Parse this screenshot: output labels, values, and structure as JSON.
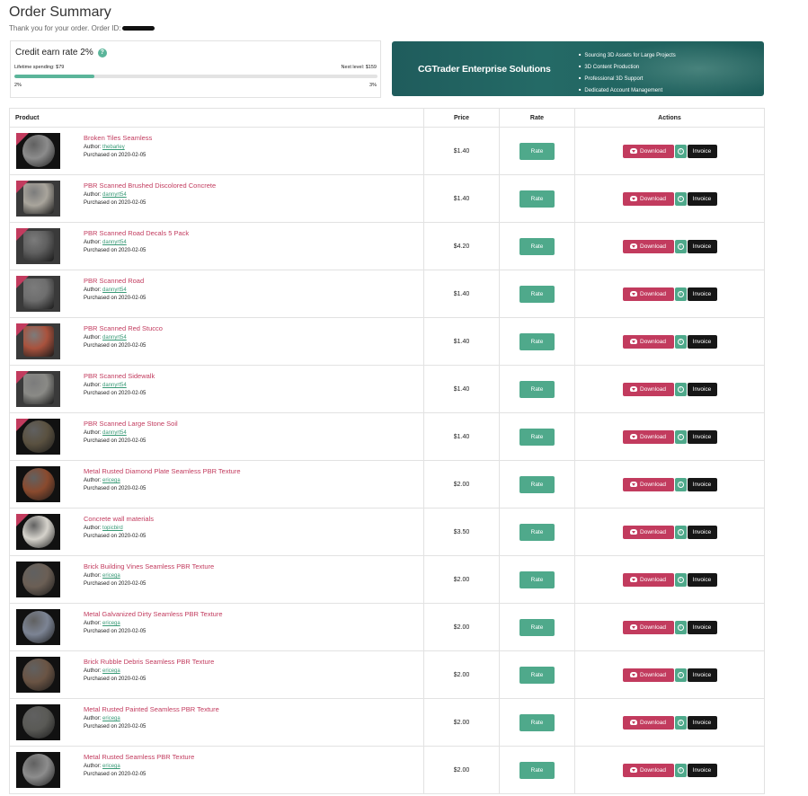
{
  "header": {
    "title": "Order Summary",
    "subtitle": "Thank you for your order. Order ID:"
  },
  "credit": {
    "title": "Credit earn rate 2%",
    "help_icon": "question-circle-icon",
    "lifetime_spending": "Lifetime spending: $79",
    "next_level": "Next level: $159",
    "progress_fraction": 0.22,
    "current_rate": "2%",
    "next_rate": "3%",
    "accent_color": "#5bb59a"
  },
  "banner": {
    "title": "CGTrader Enterprise Solutions",
    "items": [
      "Sourcing 3D Assets for Large Projects",
      "3D Content Production",
      "Professional 3D Support",
      "Dedicated Account Management"
    ]
  },
  "table": {
    "headers": {
      "product": "Product",
      "price": "Price",
      "rate": "Rate",
      "actions": "Actions"
    },
    "labels": {
      "author": "Author:",
      "purchased_prefix": "Purchased on",
      "rate_button": "Rate",
      "download_button": "Download",
      "invoice_button": "Invoice"
    },
    "rows": [
      {
        "name": "Broken Tiles Seamless",
        "author": "thebarley",
        "date": "2020-02-05",
        "price": "$1.40",
        "thumb": "sphere",
        "badge": true,
        "color": "#8c8c8c"
      },
      {
        "name": "PBR Scanned Brushed Discolored Concrete",
        "author": "dannyrt54",
        "date": "2020-02-05",
        "price": "$1.40",
        "thumb": "square",
        "badge": true,
        "color": "#a9a59c"
      },
      {
        "name": "PBR Scanned Road Decals 5 Pack",
        "author": "dannyrt54",
        "date": "2020-02-05",
        "price": "$4.20",
        "thumb": "square",
        "badge": true,
        "color": "#5f5f5f"
      },
      {
        "name": "PBR Scanned Road",
        "author": "dannyrt54",
        "date": "2020-02-05",
        "price": "$1.40",
        "thumb": "square",
        "badge": true,
        "color": "#6e6e6e"
      },
      {
        "name": "PBR Scanned Red Stucco",
        "author": "dannyrt54",
        "date": "2020-02-05",
        "price": "$1.40",
        "thumb": "square",
        "badge": true,
        "color": "#a9523d"
      },
      {
        "name": "PBR Scanned Sidewalk",
        "author": "dannyrt54",
        "date": "2020-02-05",
        "price": "$1.40",
        "thumb": "square",
        "badge": true,
        "color": "#8a8a86"
      },
      {
        "name": "PBR Scanned Large Stone Soil",
        "author": "dannyrt54",
        "date": "2020-02-05",
        "price": "$1.40",
        "thumb": "sphere",
        "badge": true,
        "color": "#5a5140"
      },
      {
        "name": "Metal Rusted Diamond Plate Seamless PBR Texture",
        "author": "ericega",
        "date": "2020-02-05",
        "price": "$2.00",
        "thumb": "sphere",
        "badge": false,
        "color": "#8a4a2e"
      },
      {
        "name": "Concrete wall materials",
        "author": "topicbird",
        "date": "2020-02-05",
        "price": "$3.50",
        "thumb": "sphere",
        "badge": true,
        "color": "#d6d3cc"
      },
      {
        "name": "Brick Building Vines Seamless PBR Texture",
        "author": "ericega",
        "date": "2020-02-05",
        "price": "$2.00",
        "thumb": "sphere",
        "badge": false,
        "color": "#6b5f55"
      },
      {
        "name": "Metal Galvanized Dirty Seamless PBR Texture",
        "author": "ericega",
        "date": "2020-02-05",
        "price": "$2.00",
        "thumb": "sphere",
        "badge": false,
        "color": "#7c8494"
      },
      {
        "name": "Brick Rubble Debris Seamless PBR Texture",
        "author": "ericega",
        "date": "2020-02-05",
        "price": "$2.00",
        "thumb": "sphere",
        "badge": false,
        "color": "#6a5444"
      },
      {
        "name": "Metal Rusted Painted Seamless PBR Texture",
        "author": "ericega",
        "date": "2020-02-05",
        "price": "$2.00",
        "thumb": "sphere",
        "badge": false,
        "color": "#5a5a56"
      },
      {
        "name": "Metal Rusted Seamless PBR Texture",
        "author": "ericega",
        "date": "2020-02-05",
        "price": "$2.00",
        "thumb": "sphere",
        "badge": false,
        "color": "#8d8d8d"
      }
    ]
  }
}
